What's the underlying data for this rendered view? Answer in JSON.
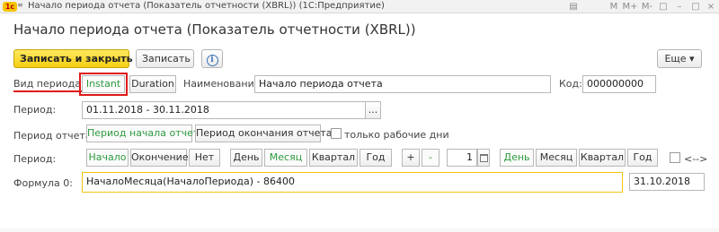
{
  "window": {
    "logo": "1c",
    "menu": "≡",
    "title": "Начало периода отчета (Показатель отчетности (XBRL))  (1С:Предприятие)",
    "controls": [
      "▤",
      "M",
      "M+",
      "M-",
      "□",
      "–",
      "□",
      "×"
    ]
  },
  "page": {
    "title": "Начало периода отчета (Показатель отчетности (XBRL))"
  },
  "toolbar": {
    "save_close": "Записать и закрыть",
    "save": "Записать",
    "info": "i",
    "more": "Еще ▾"
  },
  "form": {
    "period_kind_label": "Вид периода:",
    "period_kind_options": [
      "Instant",
      "Duration"
    ],
    "name_label": "Наименование:",
    "name_value": "Начало периода отчета",
    "code_label": "Код:",
    "code_value": "000000000",
    "period_label": "Период:",
    "period_value": "01.11.2018 - 30.11.2018",
    "period_picker": "...",
    "report_period_label": "Период отчета:",
    "report_period_options": [
      "Период начала отчета",
      "Период окончания отчета"
    ],
    "workdays_label": "только рабочие дни",
    "period2_label": "Период:",
    "period2_options": [
      "Начало",
      "Окончение",
      "Нет"
    ],
    "unit_options": [
      "День",
      "Месяц",
      "Квартал",
      "Год"
    ],
    "plus": "+",
    "minus": "-",
    "count_value": "1",
    "unit2_options": [
      "День",
      "Месяц",
      "Квартал",
      "Год"
    ],
    "arrows_label": "<-->",
    "formula_label": "Формула 0:",
    "formula_value": "НачалоМесяца(НачалоПериода) - 86400",
    "formula_result": "31.10.2018"
  },
  "colors": {
    "accent": "#f6cf12",
    "active": "#2e9a3f",
    "highlight": "#e01818"
  }
}
